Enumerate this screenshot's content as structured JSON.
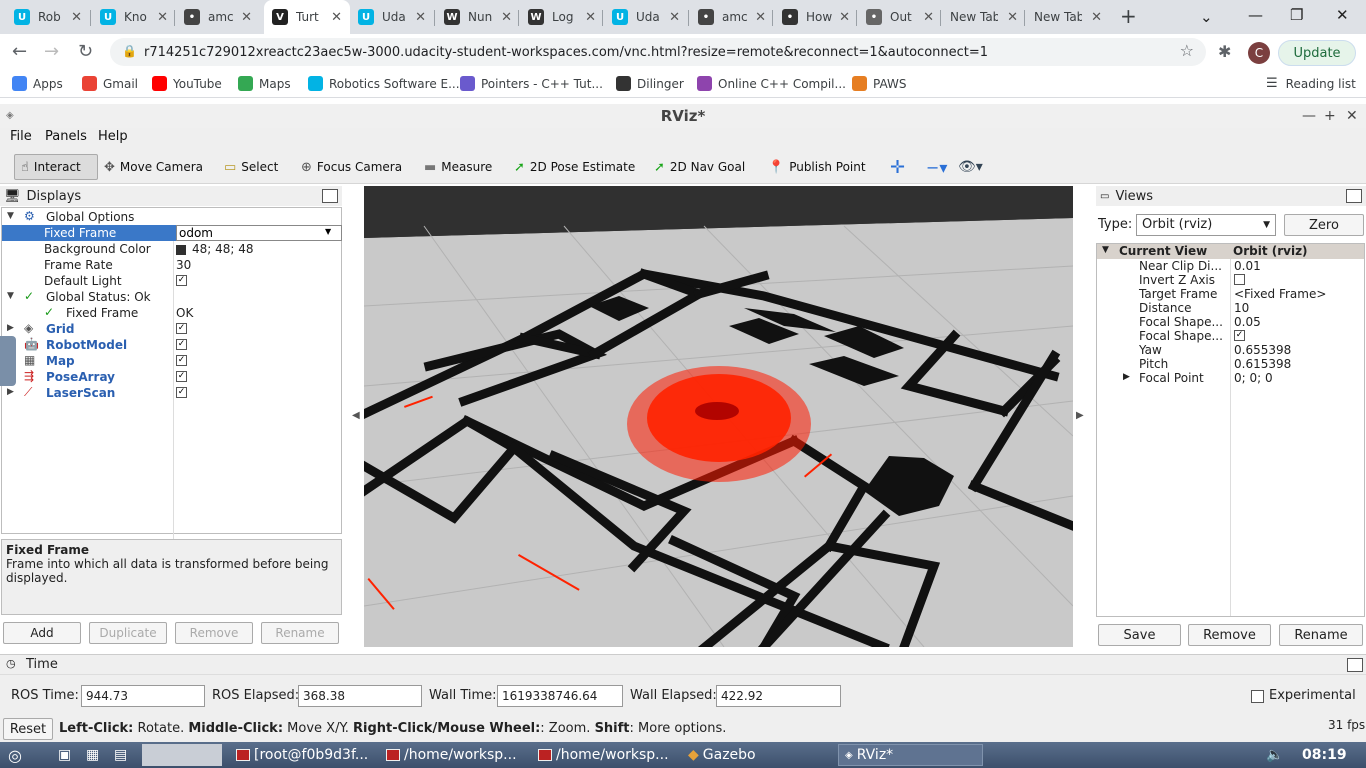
{
  "browser": {
    "tabs": [
      {
        "label": "Rob",
        "icon": "udacity-icon",
        "color": "#02b3e4"
      },
      {
        "label": "Kno",
        "icon": "udacity-icon",
        "color": "#02b3e4"
      },
      {
        "label": "amc",
        "icon": "grid-icon",
        "color": "#444444"
      },
      {
        "label": "Turt",
        "icon": "vnc-icon",
        "color": "#222222",
        "active": true
      },
      {
        "label": "Uda",
        "icon": "udacity-icon",
        "color": "#02b3e4"
      },
      {
        "label": "Nun",
        "icon": "wikipedia-icon",
        "color": "#333333"
      },
      {
        "label": "Log",
        "icon": "wikipedia-icon",
        "color": "#333333"
      },
      {
        "label": "Uda",
        "icon": "udacity-icon",
        "color": "#02b3e4"
      },
      {
        "label": "amc",
        "icon": "grid-icon",
        "color": "#444444"
      },
      {
        "label": "How",
        "icon": "github-icon",
        "color": "#333333"
      },
      {
        "label": "Out",
        "icon": "globe-icon",
        "color": "#666666"
      },
      {
        "label": "New Tab",
        "icon": "",
        "color": ""
      },
      {
        "label": "New Tab",
        "icon": "",
        "color": ""
      }
    ],
    "url": "r714251c729012xreactc23aec5w-3000.udacity-student-workspaces.com/vnc.html?resize=remote&reconnect=1&autoconnect=1",
    "profile_initial": "C",
    "update_label": "Update",
    "bookmarks": [
      {
        "label": "Apps",
        "icon": "apps-grid-icon",
        "color": "#4285f4"
      },
      {
        "label": "Gmail",
        "icon": "gmail-icon",
        "color": "#ea4335"
      },
      {
        "label": "YouTube",
        "icon": "youtube-icon",
        "color": "#ff0000"
      },
      {
        "label": "Maps",
        "icon": "maps-icon",
        "color": "#34a853"
      },
      {
        "label": "Robotics Software E...",
        "icon": "udacity-icon",
        "color": "#02b3e4"
      },
      {
        "label": "Pointers - C++ Tut...",
        "icon": "cplusplus-icon",
        "color": "#6a5acd"
      },
      {
        "label": "Dilinger",
        "icon": "dillinger-icon",
        "color": "#333333"
      },
      {
        "label": "Online C++ Compil...",
        "icon": "compiler-icon",
        "color": "#8e44ad"
      },
      {
        "label": "PAWS",
        "icon": "paws-icon",
        "color": "#e67e22"
      }
    ],
    "reading_list": "Reading list"
  },
  "rviz": {
    "title": "RViz*",
    "menu": [
      "File",
      "Panels",
      "Help"
    ],
    "tools": [
      {
        "label": "Interact",
        "icon": "cursor-icon"
      },
      {
        "label": "Move Camera",
        "icon": "move-camera-icon"
      },
      {
        "label": "Select",
        "icon": "select-icon"
      },
      {
        "label": "Focus Camera",
        "icon": "focus-camera-icon"
      },
      {
        "label": "Measure",
        "icon": "ruler-icon"
      },
      {
        "label": "2D Pose Estimate",
        "icon": "green-arrow-icon"
      },
      {
        "label": "2D Nav Goal",
        "icon": "green-arrow-icon"
      },
      {
        "label": "Publish Point",
        "icon": "map-pin-icon"
      }
    ],
    "displays": {
      "title": "Displays",
      "rows": [
        {
          "name": "Global Options",
          "value": ""
        },
        {
          "name": "Fixed Frame",
          "value": "odom"
        },
        {
          "name": "Background Color",
          "value": "48; 48; 48"
        },
        {
          "name": "Frame Rate",
          "value": "30"
        },
        {
          "name": "Default Light",
          "value": ""
        },
        {
          "name": "Global Status: Ok",
          "value": ""
        },
        {
          "name": "Fixed Frame",
          "value": "OK"
        },
        {
          "name": "Grid",
          "value": ""
        },
        {
          "name": "RobotModel",
          "value": ""
        },
        {
          "name": "Map",
          "value": ""
        },
        {
          "name": "PoseArray",
          "value": ""
        },
        {
          "name": "LaserScan",
          "value": ""
        }
      ],
      "desc_title": "Fixed Frame",
      "desc_text": "Frame into which all data is transformed before being displayed.",
      "buttons": [
        "Add",
        "Duplicate",
        "Remove",
        "Rename"
      ]
    },
    "views": {
      "title": "Views",
      "type_label": "Type:",
      "type_value": "Orbit (rviz)",
      "zero_label": "Zero",
      "header": [
        "Current View",
        "Orbit (rviz)"
      ],
      "rows": [
        {
          "name": "Near Clip Di...",
          "value": "0.01"
        },
        {
          "name": "Invert Z Axis",
          "value": ""
        },
        {
          "name": "Target Frame",
          "value": "<Fixed Frame>"
        },
        {
          "name": "Distance",
          "value": "10"
        },
        {
          "name": "Focal Shape...",
          "value": "0.05"
        },
        {
          "name": "Focal Shape...",
          "value": ""
        },
        {
          "name": "Yaw",
          "value": "0.655398"
        },
        {
          "name": "Pitch",
          "value": "0.615398"
        },
        {
          "name": "Focal Point",
          "value": "0; 0; 0"
        }
      ],
      "buttons": [
        "Save",
        "Remove",
        "Rename"
      ]
    },
    "time": {
      "title": "Time",
      "ros_time_label": "ROS Time:",
      "ros_time": "944.73",
      "ros_elapsed_label": "ROS Elapsed:",
      "ros_elapsed": "368.38",
      "wall_time_label": "Wall Time:",
      "wall_time": "1619338746.64",
      "wall_elapsed_label": "Wall Elapsed:",
      "wall_elapsed": "422.92",
      "experimental": "Experimental"
    },
    "status": {
      "reset": "Reset",
      "help_parts": [
        {
          "b": "Left-Click:",
          "t": " Rotate. "
        },
        {
          "b": "Middle-Click:",
          "t": " Move X/Y. "
        },
        {
          "b": "Right-Click/Mouse Wheel:",
          "t": ": Zoom. "
        },
        {
          "b": "Shift",
          "t": ": More options."
        }
      ],
      "fps": "31 fps"
    }
  },
  "taskbar": {
    "items": [
      "[root@f0b9d3f...",
      "/home/worksp...",
      "/home/worksp...",
      "Gazebo",
      "RViz*"
    ],
    "clock": "08:19"
  }
}
